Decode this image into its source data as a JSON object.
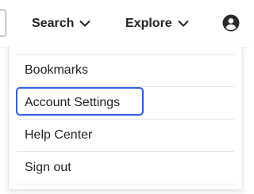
{
  "header": {
    "search_label": "Search",
    "explore_label": "Explore",
    "icons": {
      "search_chevron": "chevron-down-icon",
      "explore_chevron": "chevron-down-icon",
      "account": "user-circle-icon"
    }
  },
  "menu": {
    "focused_item": "Account Settings",
    "items": [
      {
        "label": "Bookmarks"
      },
      {
        "label": "Account Settings"
      },
      {
        "label": "Help Center"
      },
      {
        "label": "Sign out"
      }
    ]
  },
  "colors": {
    "text": "#222222",
    "focus_ring": "#2f5fe3",
    "divider": "#e4e4e4",
    "background": "#ffffff"
  }
}
